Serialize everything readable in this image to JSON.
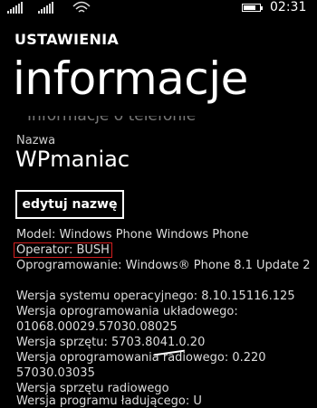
{
  "status": {
    "time": "02:31",
    "icons": [
      "signal-icon",
      "signal-icon-2",
      "wifi-icon",
      "battery-icon"
    ]
  },
  "header": {
    "section": "USTAWIENIA",
    "title": "informacje"
  },
  "device": {
    "faded_text": "Informacje o telefonie",
    "name_label": "Nazwa",
    "name_value": "WPmaniac",
    "rename_button": "edytuj nazwę"
  },
  "info": {
    "model": "Model: Windows Phone Windows Phone",
    "operator": "Operator: BUSH",
    "software": "Oprogramowanie: Windows® Phone 8.1 Update 2",
    "os_version": "Wersja systemu operacyjnego: 8.10.15116.125",
    "firmware_label": "Wersja oprogramowania układowego:",
    "firmware_value": "01068.00029.57030.08025",
    "hardware": "Wersja sprzętu: 5703.8041.0.20",
    "radio_software_label": "Wersja oprogramowania radiowego: 0.220",
    "radio_software_value": "57030.03035",
    "radio_hardware": "Wersja sprzętu radiowego",
    "bootloader": "Wersja programu ładującego: U"
  }
}
